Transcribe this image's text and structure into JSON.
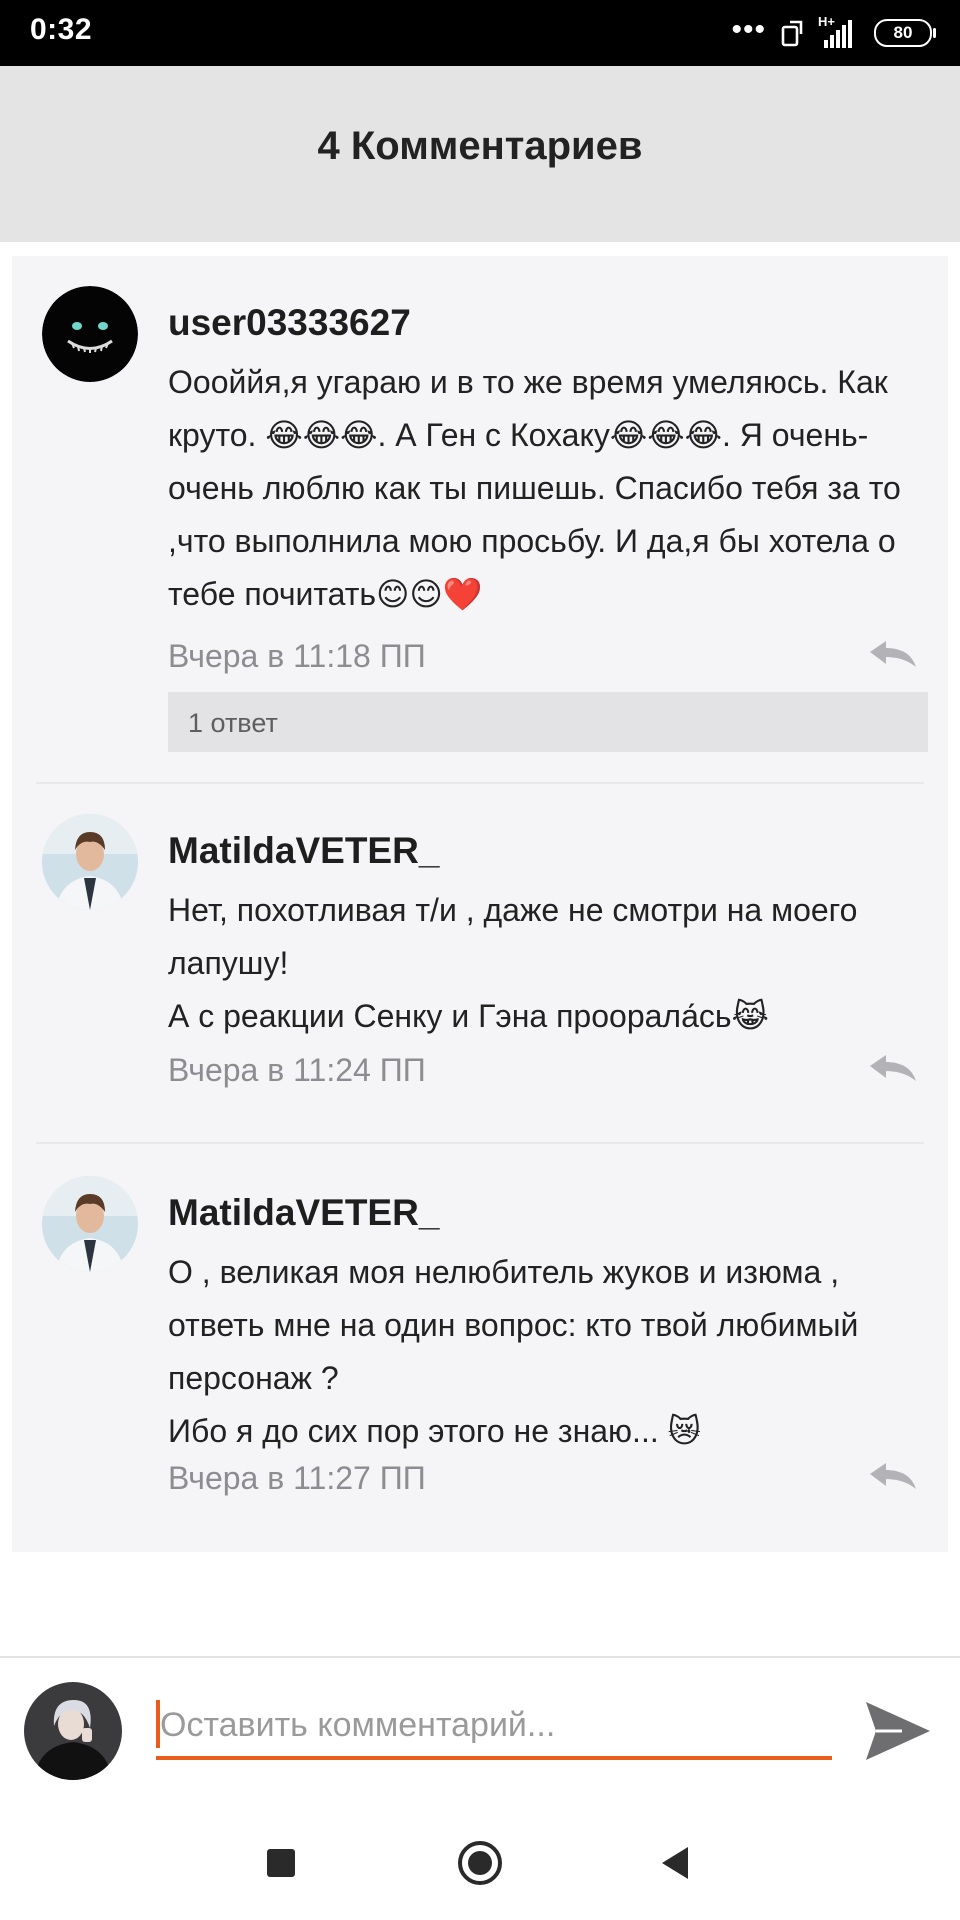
{
  "status_bar": {
    "time": "0:32",
    "network": "H+",
    "battery": "80",
    "icons": [
      "more-dots-icon",
      "screen-rotate-icon",
      "signal-icon",
      "battery-icon"
    ]
  },
  "header": {
    "title": "4 Комментариев"
  },
  "comments": [
    {
      "username": "user03333627",
      "avatar": "cheshire-cat-avatar",
      "text": "Оооййя,я угараю и в то же время умеляюсь. Как круто. 😂😂😂. А Ген с Кохаку😂😂😂. Я очень-очень люблю как ты пишешь. Спасибо тебя за то ,что выполнила мою просьбу. И да,я бы хотела о тебе почитать😊😊❤️",
      "time": "Вчера в 11:18 ПП",
      "replies_label": "1 ответ"
    },
    {
      "username": "MatildaVETER_",
      "avatar": "doctor-avatar",
      "text": "Нет, похотливая т/и , даже не смотри на моего лапушу!\nА с реакции Сенку и Гэна проорала́сь😹",
      "time": "Вчера в 11:24 ПП"
    },
    {
      "username": "MatildaVETER_",
      "avatar": "doctor-avatar",
      "text": "О , великая моя нелюбитель жуков и изюма , ответь мне на один вопрос: кто твой любимый персонаж ?\nИбо я до сих пор этого не знаю... 😿",
      "time": "Вчера в 11:27 ПП"
    }
  ],
  "composer": {
    "placeholder": "Оставить комментарий...",
    "icons": [
      "user-avatar",
      "send-icon"
    ]
  },
  "navbar": {
    "icons": [
      "recents-square-icon",
      "home-circle-icon",
      "back-triangle-icon"
    ]
  },
  "colors": {
    "accent": "#e85d1c",
    "header_bg": "#e4e4e4",
    "panel_bg": "#f5f4f7"
  }
}
